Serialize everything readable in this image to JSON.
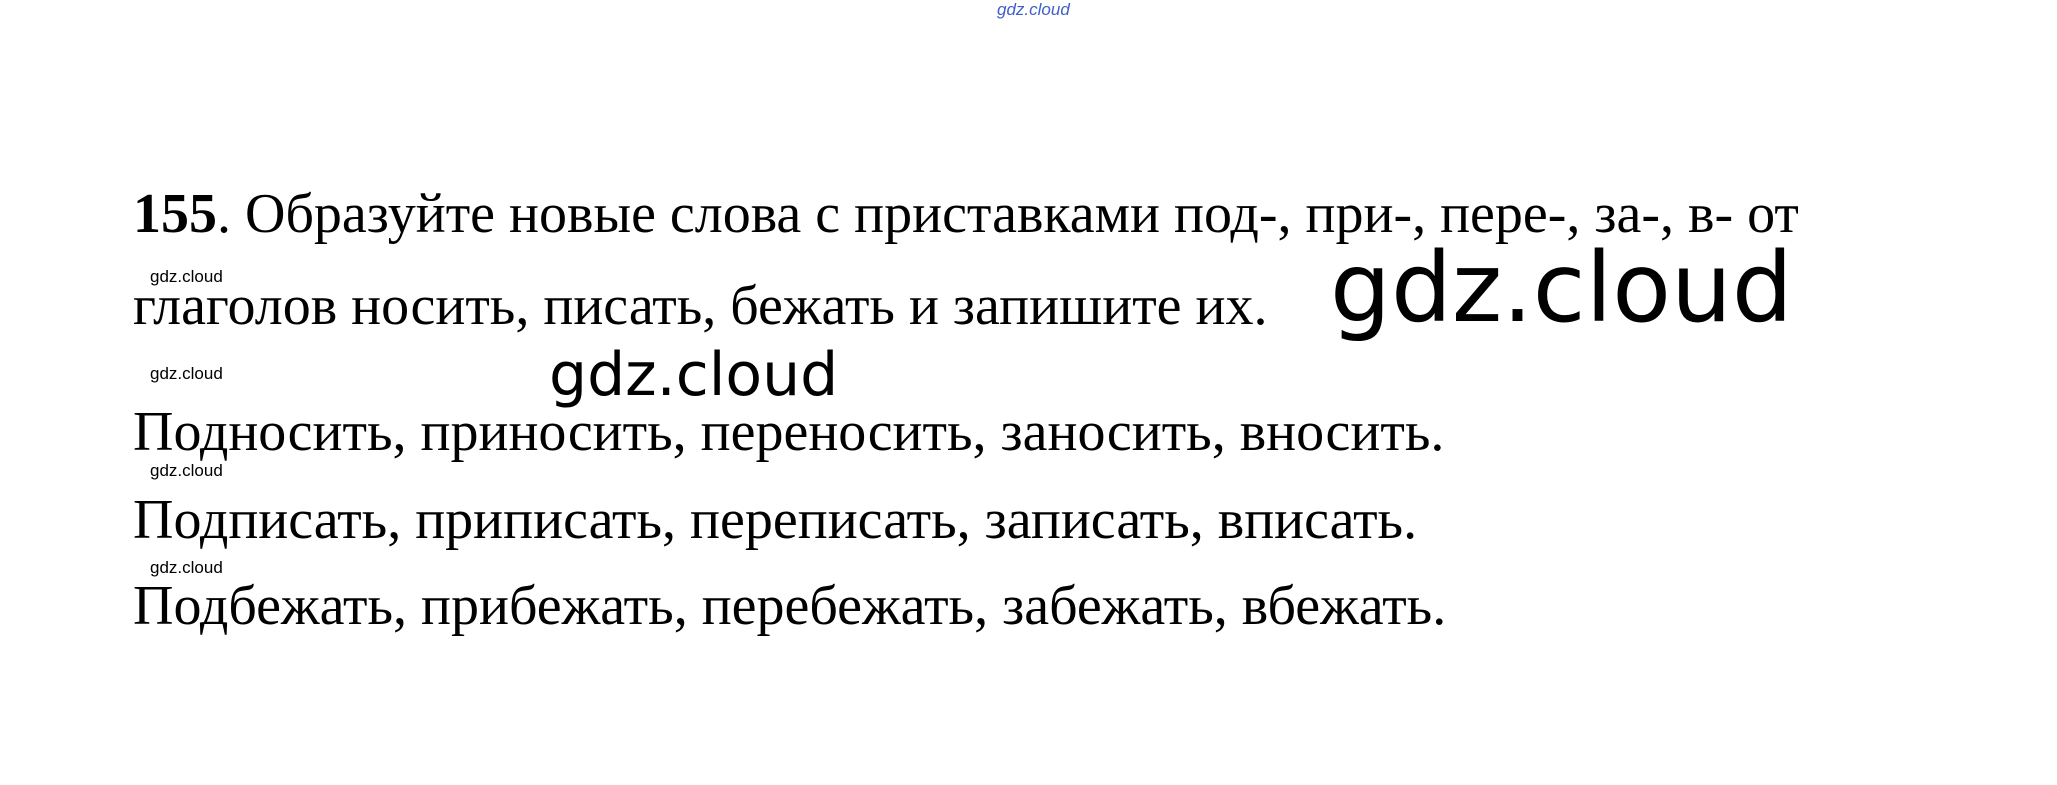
{
  "watermarks": {
    "top": "gdz.cloud",
    "small": [
      "gdz.cloud",
      "gdz.cloud",
      "gdz.cloud",
      "gdz.cloud"
    ],
    "large": "gdz.cloud",
    "medium": "gdz.cloud"
  },
  "task": {
    "number": "155",
    "line1_rest": ". Образуйте новые слова с приставками под-, при-, пере-, за-, в- от",
    "line2": "глаголов носить, писать, бежать и запишите их."
  },
  "answers": [
    "Подносить, приносить, переносить, заносить, вносить.",
    "Подписать, приписать, переписать, записать, вписать.",
    "Подбежать, прибежать, перебежать, забежать, вбежать."
  ]
}
